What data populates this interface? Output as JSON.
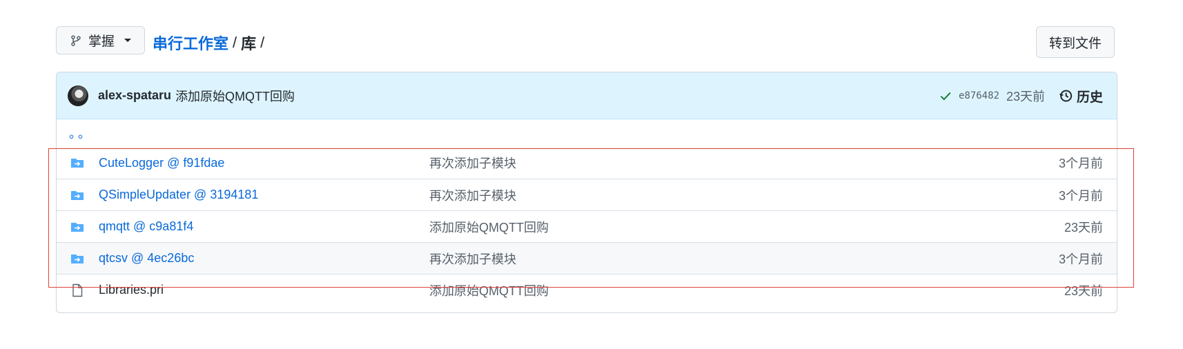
{
  "top": {
    "branch_label": "掌握",
    "repo_name": "串行工作室",
    "sep1": "/",
    "dir_name": "库",
    "sep2": "/",
    "goto_file_label": "转到文件"
  },
  "commit": {
    "author": "alex-spataru",
    "message": "添加原始QMQTT回购",
    "sha": "e876482",
    "time": "23天前",
    "history_label": "历史"
  },
  "parent_dir_label": "。。",
  "files": [
    {
      "name": "CuteLogger @ f91fdae",
      "message": "再次添加子模块",
      "age": "3个月前",
      "type": "submodule"
    },
    {
      "name": "QSimpleUpdater @ 3194181",
      "message": "再次添加子模块",
      "age": "3个月前",
      "type": "submodule"
    },
    {
      "name": "qmqtt @ c9a81f4",
      "message": "添加原始QMQTT回购",
      "age": "23天前",
      "type": "submodule"
    },
    {
      "name": "qtcsv @ 4ec26bc",
      "message": "再次添加子模块",
      "age": "3个月前",
      "type": "submodule"
    },
    {
      "name": "Libraries.pri",
      "message": "添加原始QMQTT回购",
      "age": "23天前",
      "type": "file"
    }
  ],
  "colors": {
    "link": "#0969da",
    "folder_icon": "#54aeff",
    "check": "#1a7f37",
    "highlight_box": "#e0403a"
  }
}
